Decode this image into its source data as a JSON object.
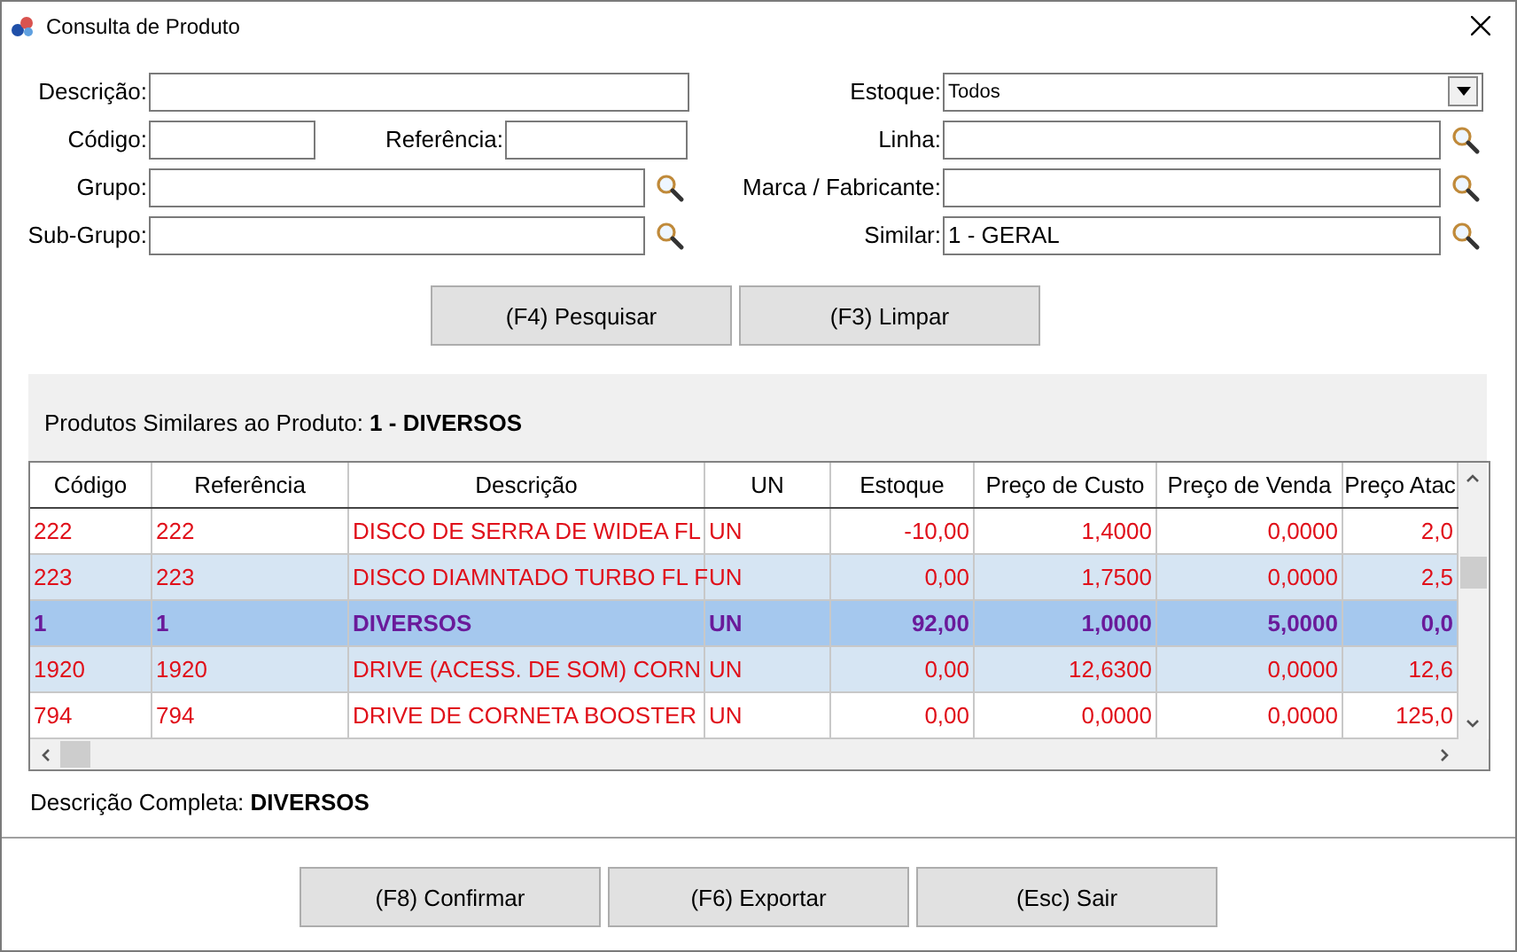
{
  "window": {
    "title": "Consulta de Produto"
  },
  "form": {
    "left": [
      {
        "label": "Descrição:",
        "kind": "wide"
      },
      {
        "label": "Código:",
        "kind": "pair",
        "label2": "Referência:"
      },
      {
        "label": "Grupo:",
        "kind": "lookup"
      },
      {
        "label": "Sub-Grupo:",
        "kind": "lookup"
      }
    ],
    "right": [
      {
        "label": "Estoque:",
        "kind": "select",
        "value": "Todos"
      },
      {
        "label": "Linha:",
        "kind": "lookup"
      },
      {
        "label": "Marca / Fabricante:",
        "kind": "lookup"
      },
      {
        "label": "Similar:",
        "kind": "lookup",
        "value": "1 - GERAL"
      }
    ]
  },
  "search_buttons": [
    "(F4) Pesquisar",
    "(F3) Limpar"
  ],
  "similar": {
    "label": "Produtos Similares ao Produto:",
    "product": "1 - DIVERSOS"
  },
  "table": {
    "columns": [
      "Código",
      "Referência",
      "Descrição",
      "UN",
      "Estoque",
      "Preço de Custo",
      "Preço de Venda",
      "Preço Atac"
    ],
    "rows": [
      {
        "cells": [
          "222",
          "222",
          "DISCO DE SERRA DE WIDEA FL",
          "UN",
          "-10,00",
          "1,4000",
          "0,0000",
          "2,0"
        ],
        "selected": false
      },
      {
        "cells": [
          "223",
          "223",
          "DISCO DIAMNTADO TURBO FL F",
          "UN",
          "0,00",
          "1,7500",
          "0,0000",
          "2,5"
        ],
        "selected": false
      },
      {
        "cells": [
          "1",
          "1",
          "DIVERSOS",
          "UN",
          "92,00",
          "1,0000",
          "5,0000",
          "0,0"
        ],
        "selected": true
      },
      {
        "cells": [
          "1920",
          "1920",
          "DRIVE (ACESS. DE SOM) CORN",
          "UN",
          "0,00",
          "12,6300",
          "0,0000",
          "12,6"
        ],
        "selected": false
      },
      {
        "cells": [
          "794",
          "794",
          "DRIVE DE CORNETA BOOSTER",
          "UN",
          "0,00",
          "0,0000",
          "0,0000",
          "125,0"
        ],
        "selected": false
      }
    ]
  },
  "full_description": {
    "label": "Descrição Completa:",
    "value": "DIVERSOS"
  },
  "footer_buttons": [
    "(F8) Confirmar",
    "(F6) Exportar",
    "(Esc) Sair"
  ]
}
